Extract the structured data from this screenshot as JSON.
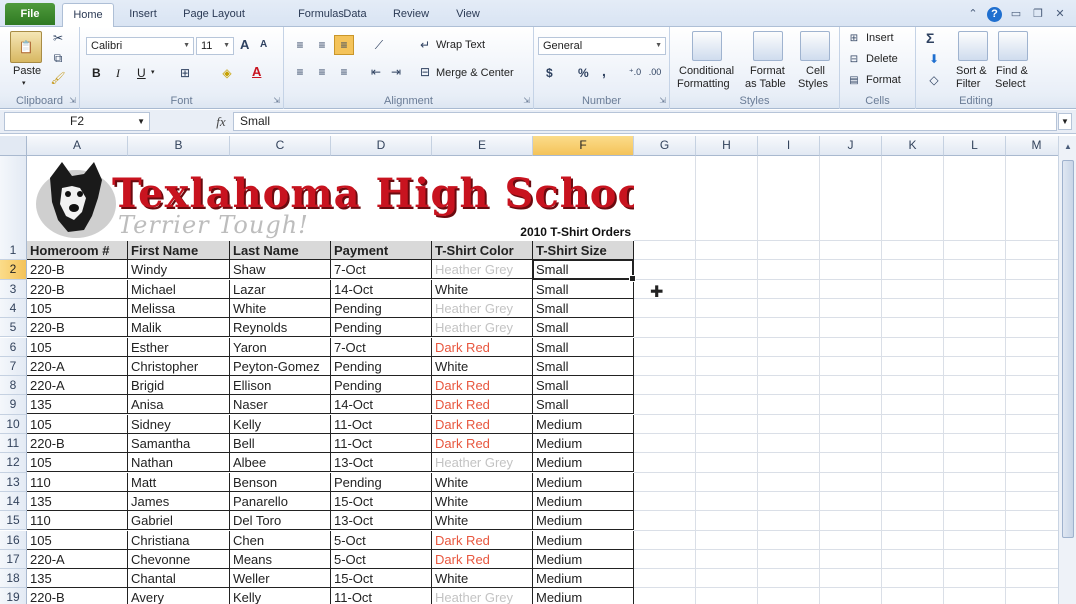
{
  "tabs": [
    "File",
    "Home",
    "Insert",
    "Page Layout",
    "Formulas",
    "Data",
    "Review",
    "View"
  ],
  "ribbon": {
    "clipboard": {
      "label": "Clipboard",
      "paste": "Paste"
    },
    "font": {
      "label": "Font",
      "name": "Calibri",
      "size": "11",
      "bold": "B",
      "italic": "I",
      "underline": "U",
      "grow": "A",
      "shrink": "A"
    },
    "alignment": {
      "label": "Alignment",
      "wrap": "Wrap Text",
      "merge": "Merge & Center"
    },
    "number": {
      "label": "Number",
      "format": "General",
      "currency": "$",
      "percent": "%",
      "comma": ","
    },
    "styles": {
      "label": "Styles",
      "conditional_1": "Conditional",
      "conditional_2": "Formatting",
      "format_table_1": "Format",
      "format_table_2": "as Table",
      "cell_styles_1": "Cell",
      "cell_styles_2": "Styles"
    },
    "cells": {
      "label": "Cells",
      "insert": "Insert",
      "delete": "Delete",
      "format": "Format"
    },
    "editing": {
      "label": "Editing",
      "sort_1": "Sort &",
      "sort_2": "Filter",
      "find_1": "Find &",
      "find_2": "Select",
      "sigma": "Σ"
    }
  },
  "formula_bar": {
    "name_box": "F2",
    "fx": "fx",
    "value": "Small"
  },
  "columns": [
    "A",
    "B",
    "C",
    "D",
    "E",
    "F",
    "G",
    "H",
    "I",
    "J",
    "K",
    "L",
    "M"
  ],
  "selected_column": "F",
  "selected_row": "2",
  "banner": {
    "title": "Texlahoma High School",
    "subtitle": "Terrier Tough!",
    "caption": "2010 T-Shirt Orders"
  },
  "table": {
    "headers": [
      "Homeroom #",
      "First Name",
      "Last Name",
      "Payment",
      "T-Shirt Color",
      "T-Shirt Size"
    ],
    "rows": [
      [
        "220-B",
        "Windy",
        "Shaw",
        "7-Oct",
        "Heather Grey",
        "Small"
      ],
      [
        "220-B",
        "Michael",
        "Lazar",
        "14-Oct",
        "White",
        "Small"
      ],
      [
        "105",
        "Melissa",
        "White",
        "Pending",
        "Heather Grey",
        "Small"
      ],
      [
        "220-B",
        "Malik",
        "Reynolds",
        "Pending",
        "Heather Grey",
        "Small"
      ],
      [
        "105",
        "Esther",
        "Yaron",
        "7-Oct",
        "Dark Red",
        "Small"
      ],
      [
        "220-A",
        "Christopher",
        "Peyton-Gomez",
        "Pending",
        "White",
        "Small"
      ],
      [
        "220-A",
        "Brigid",
        "Ellison",
        "Pending",
        "Dark Red",
        "Small"
      ],
      [
        "135",
        "Anisa",
        "Naser",
        "14-Oct",
        "Dark Red",
        "Small"
      ],
      [
        "105",
        "Sidney",
        "Kelly",
        "11-Oct",
        "Dark Red",
        "Medium"
      ],
      [
        "220-B",
        "Samantha",
        "Bell",
        "11-Oct",
        "Dark Red",
        "Medium"
      ],
      [
        "105",
        "Nathan",
        "Albee",
        "13-Oct",
        "Heather Grey",
        "Medium"
      ],
      [
        "110",
        "Matt",
        "Benson",
        "Pending",
        "White",
        "Medium"
      ],
      [
        "135",
        "James",
        "Panarello",
        "15-Oct",
        "White",
        "Medium"
      ],
      [
        "110",
        "Gabriel",
        "Del Toro",
        "13-Oct",
        "White",
        "Medium"
      ],
      [
        "105",
        "Christiana",
        "Chen",
        "5-Oct",
        "Dark Red",
        "Medium"
      ],
      [
        "220-A",
        "Chevonne",
        "Means",
        "5-Oct",
        "Dark Red",
        "Medium"
      ],
      [
        "135",
        "Chantal",
        "Weller",
        "15-Oct",
        "White",
        "Medium"
      ],
      [
        "220-B",
        "Avery",
        "Kelly",
        "11-Oct",
        "Heather Grey",
        "Medium"
      ]
    ]
  },
  "colors": {
    "dark_red": "#e8573f",
    "heather_grey": "#c3c3c3",
    "white_text": "#222222",
    "selection": "#f4c35a"
  }
}
